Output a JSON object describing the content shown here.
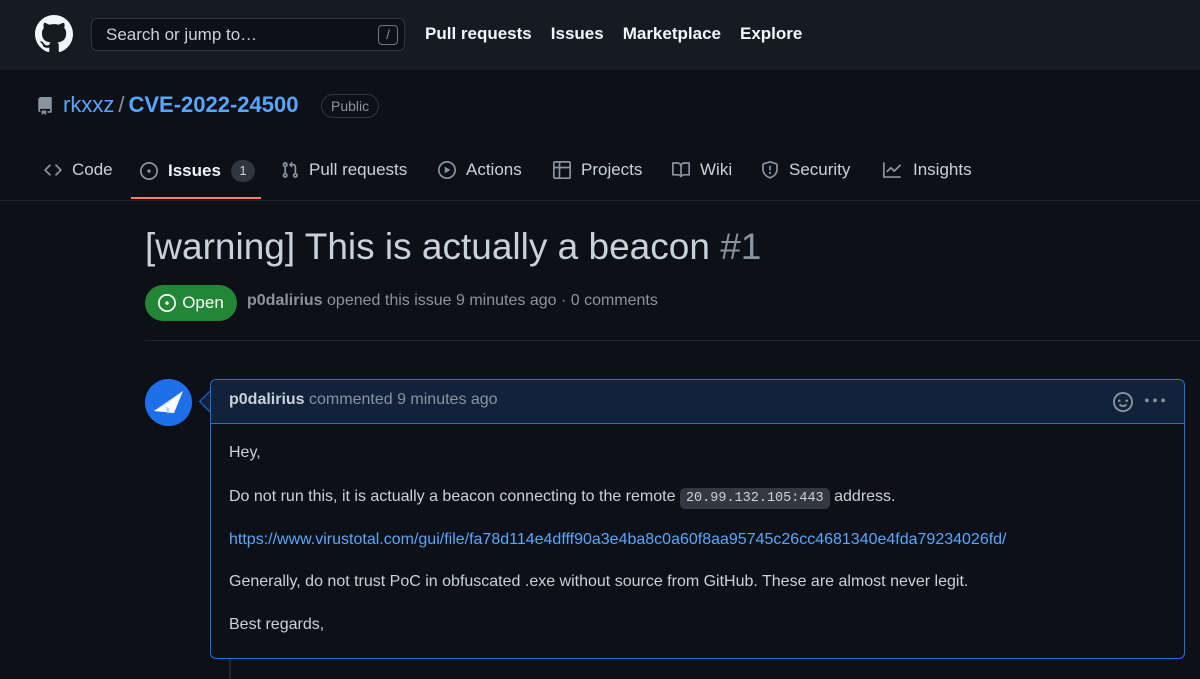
{
  "header": {
    "search_placeholder": "Search or jump to…",
    "search_shortcut": "/",
    "nav": [
      "Pull requests",
      "Issues",
      "Marketplace",
      "Explore"
    ]
  },
  "repo": {
    "owner": "rkxxz",
    "separator": "/",
    "name": "CVE-2022-24500",
    "visibility": "Public"
  },
  "tabs": [
    {
      "label": "Code",
      "icon": "code-icon"
    },
    {
      "label": "Issues",
      "icon": "issue-opened-icon",
      "count": "1",
      "active": true
    },
    {
      "label": "Pull requests",
      "icon": "git-pull-request-icon"
    },
    {
      "label": "Actions",
      "icon": "play-icon"
    },
    {
      "label": "Projects",
      "icon": "table-icon"
    },
    {
      "label": "Wiki",
      "icon": "book-icon"
    },
    {
      "label": "Security",
      "icon": "shield-icon"
    },
    {
      "label": "Insights",
      "icon": "graph-icon"
    }
  ],
  "issue": {
    "title": "[warning] This is actually a beacon",
    "number": "#1",
    "state": "Open",
    "author": "p0dalirius",
    "meta_text": "opened this issue 9 minutes ago · 0 comments"
  },
  "comment": {
    "author": "p0dalirius",
    "header_text": "commented 9 minutes ago",
    "greeting": "Hey,",
    "line1_before": "Do not run this, it is actually a beacon connecting to the remote",
    "line1_code": "20.99.132.105:443",
    "line1_after": "address.",
    "link": "https://www.virustotal.com/gui/file/fa78d114e4dfff90a3e4ba8c0a60f8aa95745c26cc4681340e4fda79234026fd/",
    "line3": "Generally, do not trust PoC in obfuscated .exe without source from GitHub. These are almost never legit.",
    "signoff": "Best regards,"
  },
  "colors": {
    "background": "#0d1117",
    "header_bg": "#161b22",
    "accent_link": "#58a6ff",
    "open_green": "#238636",
    "tab_underline": "#f78166",
    "comment_border": "#1f6feb"
  }
}
